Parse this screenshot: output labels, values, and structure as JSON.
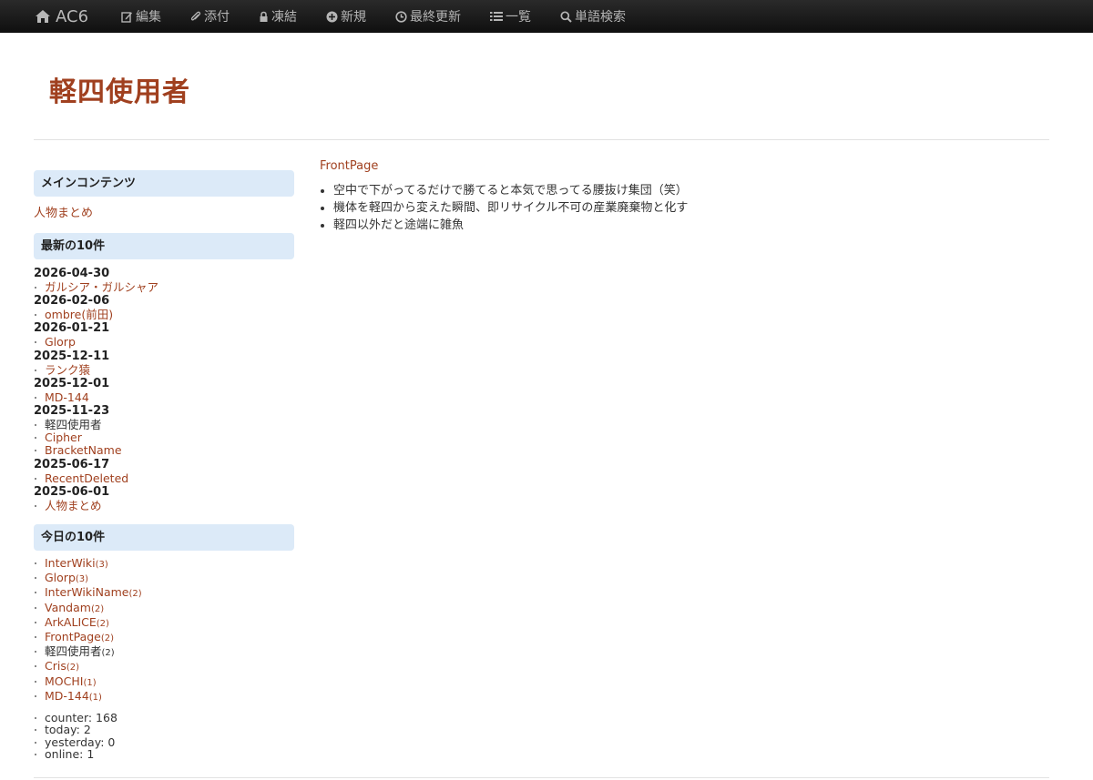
{
  "navbar": {
    "brand": "AC6",
    "items": [
      {
        "label": "編集",
        "icon": "edit-icon"
      },
      {
        "label": "添付",
        "icon": "paperclip-icon"
      },
      {
        "label": "凍結",
        "icon": "lock-icon"
      },
      {
        "label": "新規",
        "icon": "plus-circle-icon"
      },
      {
        "label": "最終更新",
        "icon": "clock-icon"
      },
      {
        "label": "一覧",
        "icon": "list-icon"
      },
      {
        "label": "単語検索",
        "icon": "search-icon"
      }
    ]
  },
  "page": {
    "title": "軽四使用者"
  },
  "sidebar": {
    "main_contents": {
      "heading": "メインコンテンツ",
      "link": "人物まとめ"
    },
    "recent": {
      "heading": "最新の10件",
      "groups": [
        {
          "date": "2026-04-30",
          "items": [
            "ガルシア・ガルシャア"
          ]
        },
        {
          "date": "2026-02-06",
          "items": [
            "ombre(前田)"
          ]
        },
        {
          "date": "2026-01-21",
          "items": [
            "Glorp"
          ]
        },
        {
          "date": "2025-12-11",
          "items": [
            "ランク猿"
          ]
        },
        {
          "date": "2025-12-01",
          "items": [
            "MD-144"
          ]
        },
        {
          "date": "2025-11-23",
          "items": [
            "軽四使用者",
            "Cipher",
            "BracketName"
          ]
        },
        {
          "date": "2025-06-17",
          "items": [
            "RecentDeleted"
          ]
        },
        {
          "date": "2025-06-01",
          "items": [
            "人物まとめ"
          ]
        }
      ]
    },
    "today": {
      "heading": "今日の10件",
      "items": [
        {
          "name": "InterWiki",
          "count": "(3)"
        },
        {
          "name": "Glorp",
          "count": "(3)"
        },
        {
          "name": "InterWikiName",
          "count": "(2)"
        },
        {
          "name": "Vandam",
          "count": "(2)"
        },
        {
          "name": "ArkALICE",
          "count": "(2)"
        },
        {
          "name": "FrontPage",
          "count": "(2)"
        },
        {
          "name": "軽四使用者",
          "count": "(2)"
        },
        {
          "name": "Cris",
          "count": "(2)"
        },
        {
          "name": "MOCHI",
          "count": "(1)"
        },
        {
          "name": "MD-144",
          "count": "(1)"
        }
      ]
    },
    "stats": [
      "counter: 168",
      "today: 2",
      "yesterday: 0",
      "online: 1"
    ]
  },
  "main": {
    "breadcrumb": "FrontPage",
    "items": [
      "空中で下がってるだけで勝てると本気で思ってる腰抜け集団（笑）",
      "機体を軽四から変えた瞬間、即リサイクル不可の産業廃棄物と化す",
      "軽四以外だと途端に雑魚"
    ]
  },
  "colors": {
    "link": "#a0401f",
    "panel_bg": "#dceaf8",
    "navbar_bg": "#1a1a1a"
  }
}
